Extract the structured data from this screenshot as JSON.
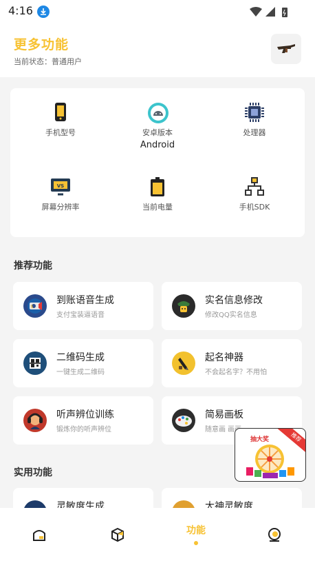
{
  "status_bar": {
    "time": "4:16"
  },
  "header": {
    "title": "更多功能",
    "status": "当前状态：普通用户"
  },
  "device_info": [
    {
      "label": "手机型号",
      "value": "",
      "icon": "phone-icon"
    },
    {
      "label": "安卓版本",
      "value": "Android",
      "icon": "android-icon"
    },
    {
      "label": "处理器",
      "value": "",
      "icon": "chip-icon"
    },
    {
      "label": "屏幕分辨率",
      "value": "",
      "icon": "monitor-icon"
    },
    {
      "label": "当前电量",
      "value": "",
      "icon": "battery-icon"
    },
    {
      "label": "手机SDK",
      "value": "",
      "icon": "sdk-icon"
    }
  ],
  "sections": {
    "recommended": "推荐功能",
    "practical": "实用功能"
  },
  "recommended": [
    {
      "title": "到账语音生成",
      "subtitle": "支付宝装逼语音",
      "icon": "alipay-voice-icon"
    },
    {
      "title": "实名信息修改",
      "subtitle": "修改QQ实名信息",
      "icon": "realname-icon"
    },
    {
      "title": "二维码生成",
      "subtitle": "一键生成二维码",
      "icon": "qrcode-icon"
    },
    {
      "title": "起名神器",
      "subtitle": "不会起名字？不用怕",
      "icon": "pen-icon"
    },
    {
      "title": "听声辨位训练",
      "subtitle": "锻炼你的听声辨位",
      "icon": "listen-icon"
    },
    {
      "title": "简易画板",
      "subtitle": "随意画 画画…",
      "icon": "palette-icon"
    }
  ],
  "practical": [
    {
      "title": "灵敏度生成",
      "icon": "sensitivity-icon"
    },
    {
      "title": "大神灵敏度",
      "icon": "pro-sensitivity-icon"
    }
  ],
  "lottery": {
    "title": "抽大奖",
    "badge": "推荐"
  },
  "bottom_nav": [
    {
      "label": "",
      "icon": "home-icon"
    },
    {
      "label": "",
      "icon": "box-icon"
    },
    {
      "label": "功能",
      "icon": "",
      "active": true
    },
    {
      "label": "",
      "icon": "profile-icon"
    }
  ],
  "colors": {
    "accent": "#f7c233",
    "background": "#f4f4f4"
  }
}
